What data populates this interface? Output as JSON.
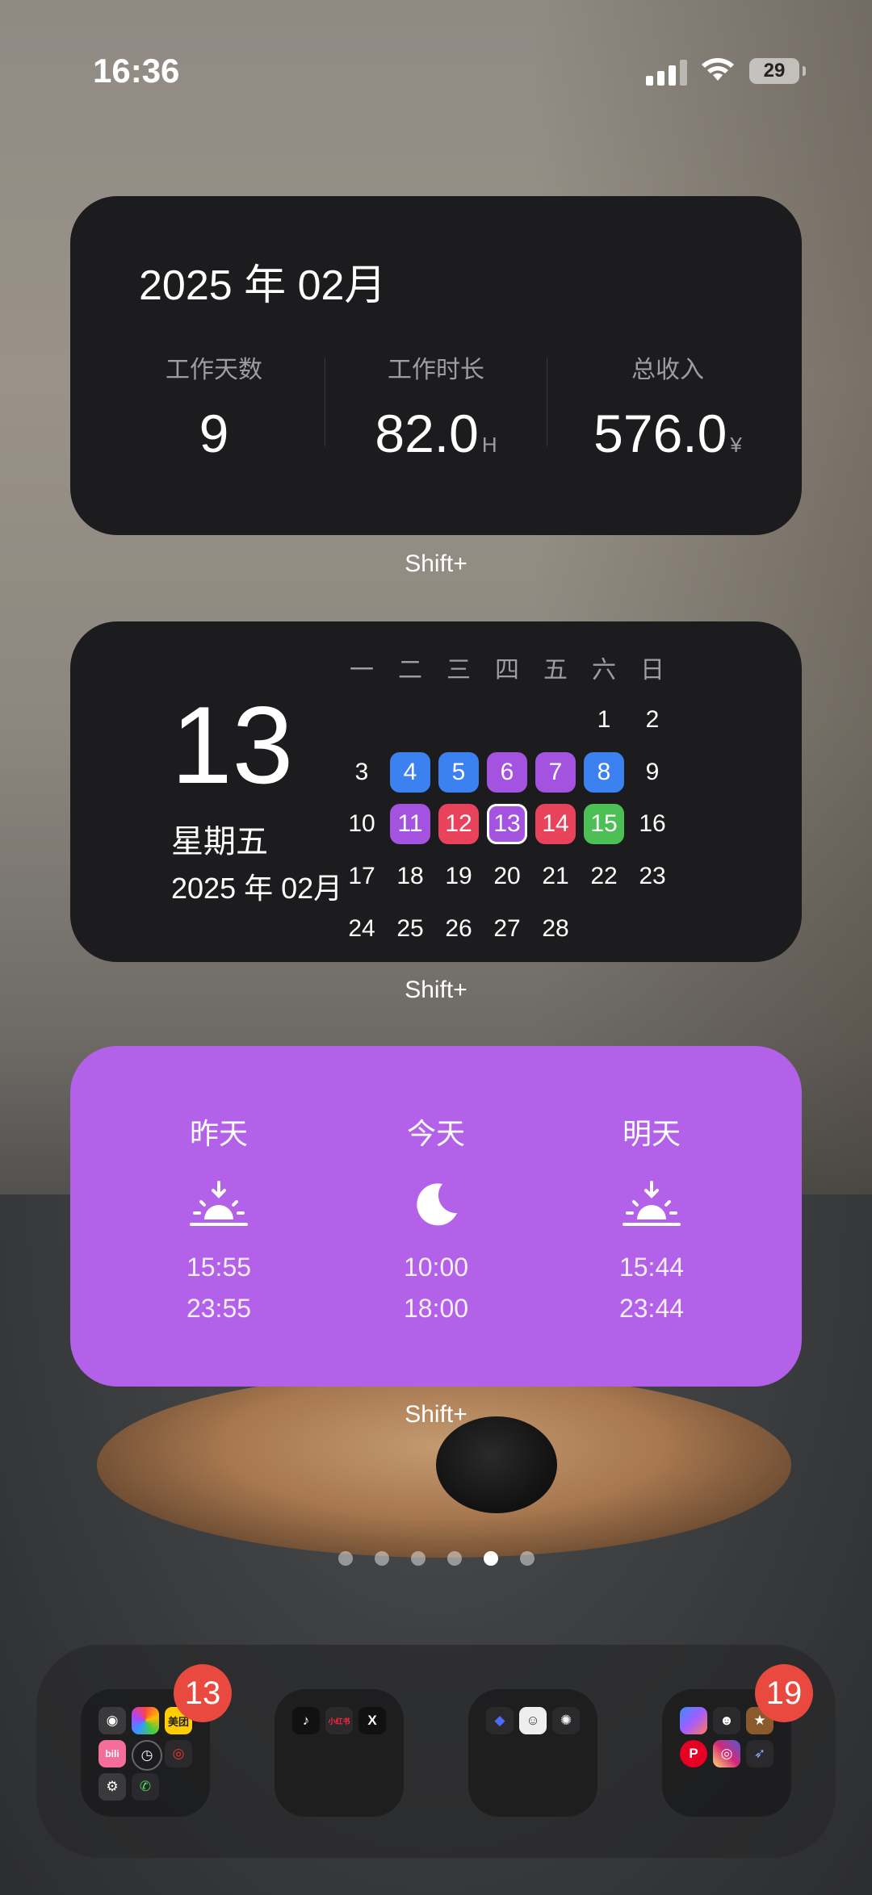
{
  "status_bar": {
    "time": "16:36",
    "battery": "29"
  },
  "widget_monthly": {
    "title": "2025 年 02月",
    "stats": [
      {
        "label": "工作天数",
        "value": "9",
        "unit": ""
      },
      {
        "label": "工作时长",
        "value": "82.0",
        "unit": "H"
      },
      {
        "label": "总收入",
        "value": "576.0",
        "unit": "¥"
      }
    ],
    "app_name": "Shift+"
  },
  "widget_calendar": {
    "day": "13",
    "weekday": "星期五",
    "year_month": "2025 年 02月",
    "weekday_headers": [
      "一",
      "二",
      "三",
      "四",
      "五",
      "六",
      "日"
    ],
    "weeks": [
      [
        null,
        null,
        null,
        null,
        null,
        "1",
        "2"
      ],
      [
        "3",
        "4",
        "5",
        "6",
        "7",
        "8",
        "9"
      ],
      [
        "10",
        "11",
        "12",
        "13",
        "14",
        "15",
        "16"
      ],
      [
        "17",
        "18",
        "19",
        "20",
        "21",
        "22",
        "23"
      ],
      [
        "24",
        "25",
        "26",
        "27",
        "28",
        null,
        null
      ]
    ],
    "highlights": {
      "4": "#3b82f0",
      "5": "#3b82f0",
      "6": "#a453e0",
      "7": "#a453e0",
      "8": "#3b82f0",
      "11": "#a453e0",
      "12": "#e8435a",
      "13": "#a453e0",
      "14": "#e8435a",
      "15": "#4cbf55"
    },
    "today": "13",
    "app_name": "Shift+"
  },
  "widget_shifts": {
    "columns": [
      {
        "day": "昨天",
        "icon": "sunrise-icon",
        "start": "15:55",
        "end": "23:55"
      },
      {
        "day": "今天",
        "icon": "moon-icon",
        "start": "10:00",
        "end": "18:00"
      },
      {
        "day": "明天",
        "icon": "sunrise-icon",
        "start": "15:44",
        "end": "23:44"
      }
    ],
    "background": "#b261e8",
    "app_name": "Shift+"
  },
  "page_dots": {
    "count": 6,
    "active_index": 4
  },
  "dock": {
    "folders": [
      {
        "badge": "13",
        "apps": [
          "camera-icon",
          "photos-icon",
          "meituan-icon",
          "bilibili-icon",
          "clock-icon",
          "netease-music-icon",
          "settings-icon",
          "phone-icon"
        ]
      },
      {
        "badge": null,
        "apps": [
          "tiktok-icon",
          "xiaohongshu-icon",
          "x-icon"
        ]
      },
      {
        "badge": null,
        "apps": [
          "deepseek-icon",
          "avatar-app-icon",
          "chatgpt-icon"
        ]
      },
      {
        "badge": "19",
        "apps": [
          "copilot-icon",
          "bot-icon",
          "game-icon",
          "pinterest-icon",
          "instagram-icon",
          "rocket-icon"
        ]
      }
    ],
    "mini_labels": {
      "meituan": "美团",
      "bilibili": "bili",
      "xiaohongshu": "小红书",
      "x": "X"
    }
  }
}
